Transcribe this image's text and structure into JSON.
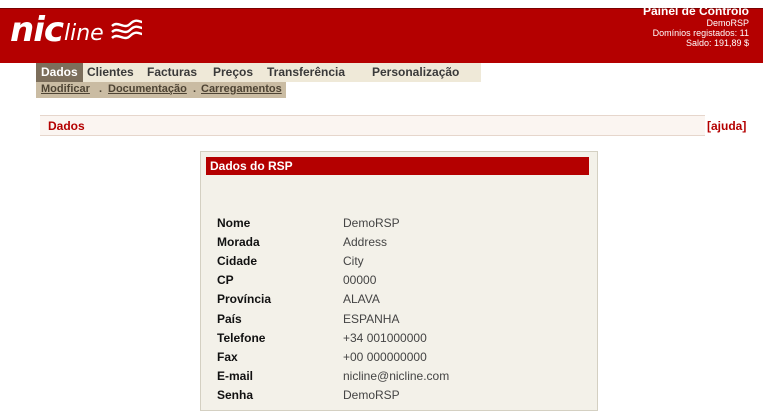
{
  "brand": {
    "logo_main": "nic",
    "logo_sub": "line"
  },
  "account": {
    "panel_title": "Painel de Controlo",
    "user": "DemoRSP",
    "domains": "Domínios registados: 11",
    "balance": "Saldo: 191,89 $"
  },
  "nav": {
    "items": [
      {
        "label": "Dados",
        "active": true
      },
      {
        "label": "Clientes",
        "active": false
      },
      {
        "label": "Facturas",
        "active": false
      },
      {
        "label": "Preços",
        "active": false
      },
      {
        "label": "Transferência",
        "active": false
      },
      {
        "label": "Personalização",
        "active": false
      }
    ],
    "subitems": [
      "Modificar",
      "Documentação",
      "Carregamentos"
    ],
    "separator": "."
  },
  "section": {
    "title": "Dados",
    "help": "[ajuda]"
  },
  "card": {
    "title": "Dados do RSP",
    "rows": [
      {
        "label": "Nome",
        "value": "DemoRSP"
      },
      {
        "label": "Morada",
        "value": "Address"
      },
      {
        "label": "Cidade",
        "value": "City"
      },
      {
        "label": "CP",
        "value": "00000"
      },
      {
        "label": "Província",
        "value": "ALAVA"
      },
      {
        "label": "País",
        "value": "ESPANHA"
      },
      {
        "label": "Telefone",
        "value": "+34 001000000"
      },
      {
        "label": "Fax",
        "value": "+00 000000000"
      },
      {
        "label": "E-mail",
        "value": "nicline@nicline.com"
      },
      {
        "label": "Senha",
        "value": "DemoRSP"
      }
    ]
  },
  "colors": {
    "brand_red": "#b40000",
    "nav_bg": "#efe9d8",
    "nav_active": "#7c6e5b",
    "subnav_bg": "#cabca3",
    "card_bg": "#f3f1e9"
  }
}
